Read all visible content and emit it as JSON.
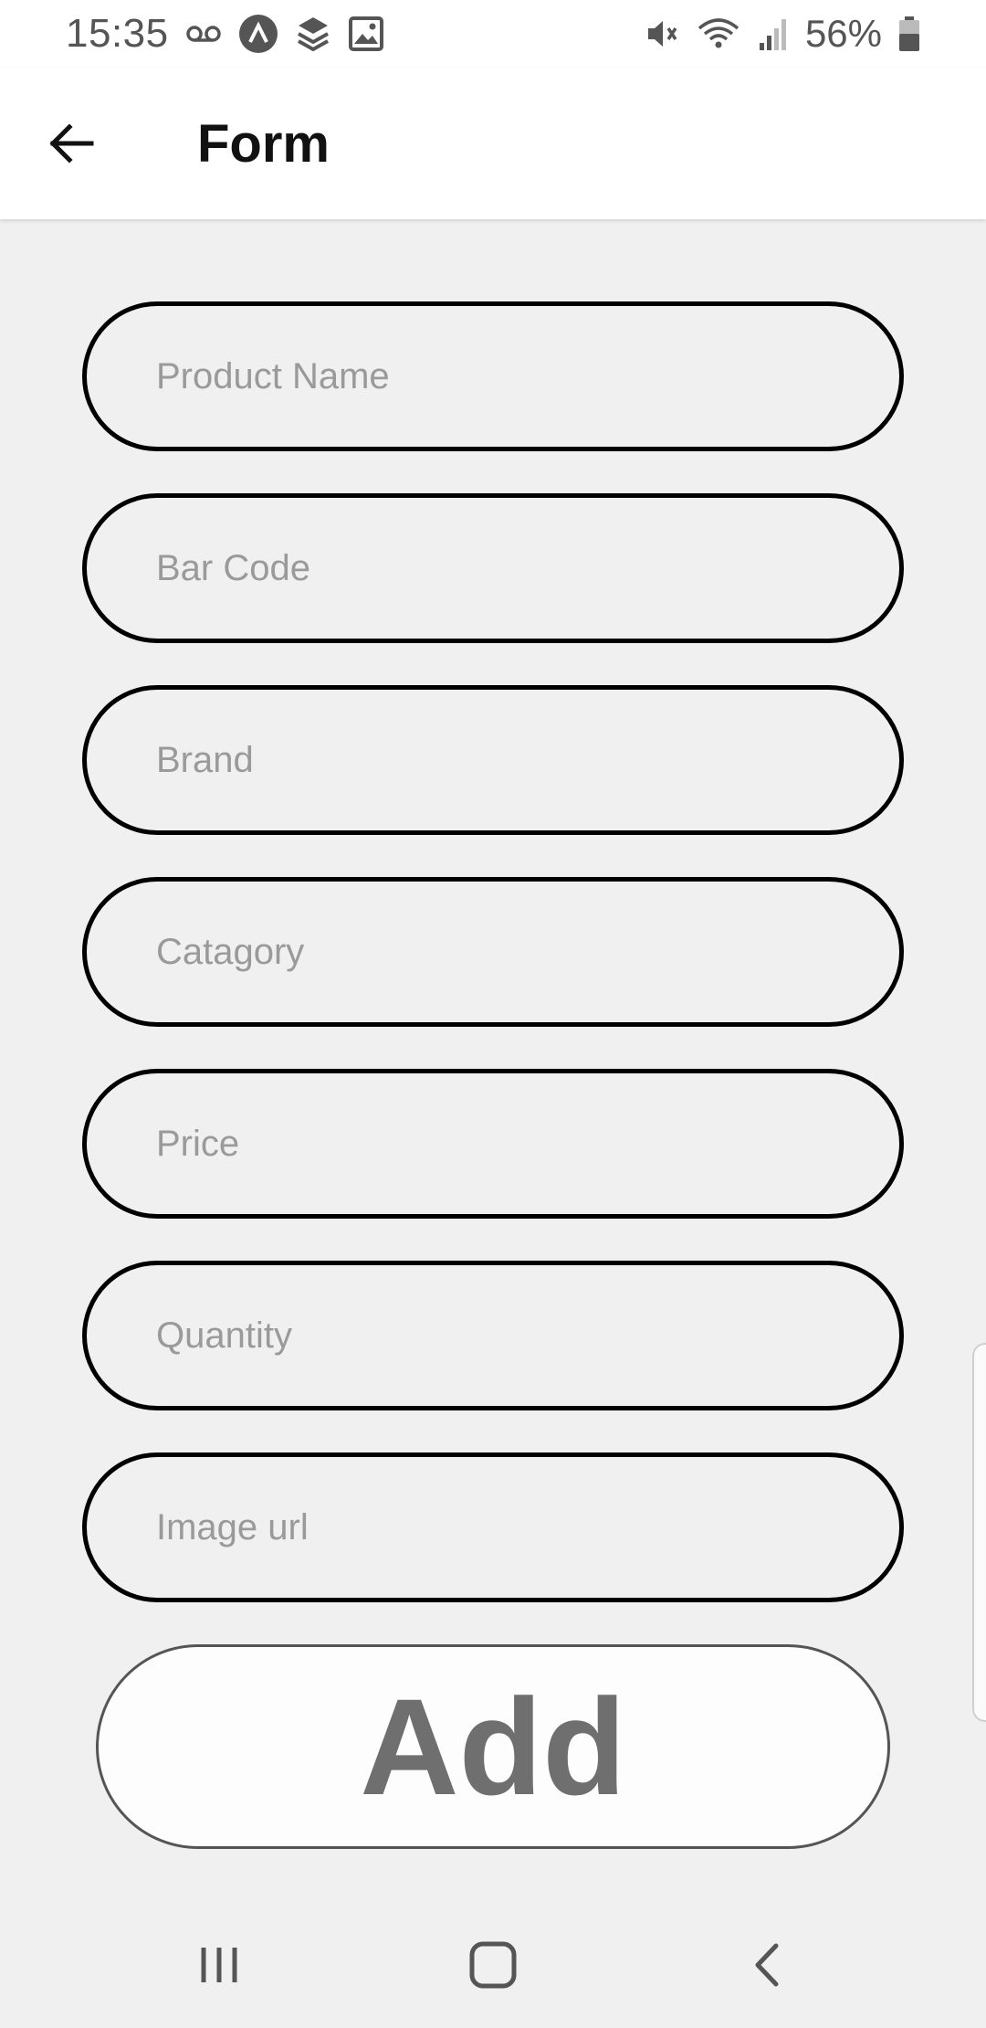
{
  "status_bar": {
    "time": "15:35",
    "battery_percent": "56%",
    "icons": [
      "voicemail-icon",
      "app-a-icon",
      "app-layers-icon",
      "gallery-icon",
      "mute-icon",
      "wifi-icon",
      "signal-icon",
      "battery-icon"
    ]
  },
  "app_bar": {
    "title": "Form",
    "back_icon": "arrow-left-icon"
  },
  "form": {
    "fields": [
      {
        "name": "product-name",
        "placeholder": "Product Name",
        "value": ""
      },
      {
        "name": "bar-code",
        "placeholder": "Bar Code",
        "value": ""
      },
      {
        "name": "brand",
        "placeholder": "Brand",
        "value": ""
      },
      {
        "name": "catagory",
        "placeholder": "Catagory",
        "value": ""
      },
      {
        "name": "price",
        "placeholder": "Price",
        "value": ""
      },
      {
        "name": "quantity",
        "placeholder": "Quantity",
        "value": ""
      },
      {
        "name": "image-url",
        "placeholder": "Image url",
        "value": ""
      }
    ],
    "submit_label": "Add"
  },
  "nav_bar": {
    "items": [
      "recent-apps-icon",
      "home-icon",
      "back-icon"
    ]
  },
  "colors": {
    "background": "#f0f0f0",
    "field_border": "#000000",
    "placeholder": "#9a9a9a",
    "button_text": "#6f6f6f"
  }
}
